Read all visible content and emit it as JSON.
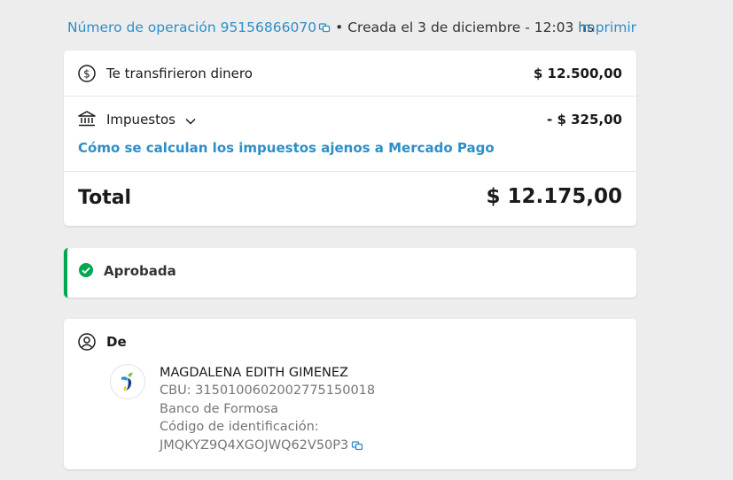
{
  "header": {
    "operation_label": "Número de operación 95156866070",
    "bullet": "•",
    "created_text": "Creada el 3 de diciembre - 12:03 hs",
    "print_label": "Imprimir"
  },
  "summary": {
    "received_label": "Te transfirieron dinero",
    "received_amount": "$ 12.500,00",
    "taxes_label": "Impuestos",
    "taxes_amount": "- $ 325,00",
    "taxes_link": "Cómo se calculan los impuestos ajenos a Mercado Pago",
    "total_label": "Total",
    "total_amount": "$ 12.175,00"
  },
  "status": {
    "label": "Aprobada",
    "color": "#00a650"
  },
  "sender": {
    "section_label": "De",
    "name": "MAGDALENA EDITH GIMENEZ",
    "cbu": "CBU: 3150100602002775150018",
    "bank": "Banco de Formosa",
    "id_label": "Código de identificación:",
    "id_code": "JMQKYZ9Q4XGOJWQ62V50P3"
  },
  "icons": [
    "copy-icon",
    "dollar-circle-icon",
    "bank-icon",
    "chevron-down-icon",
    "check-circle-icon",
    "user-circle-icon",
    "bank-logo"
  ],
  "colors": {
    "link": "#2d8ec9",
    "approved": "#00a650",
    "background": "#ededed"
  }
}
